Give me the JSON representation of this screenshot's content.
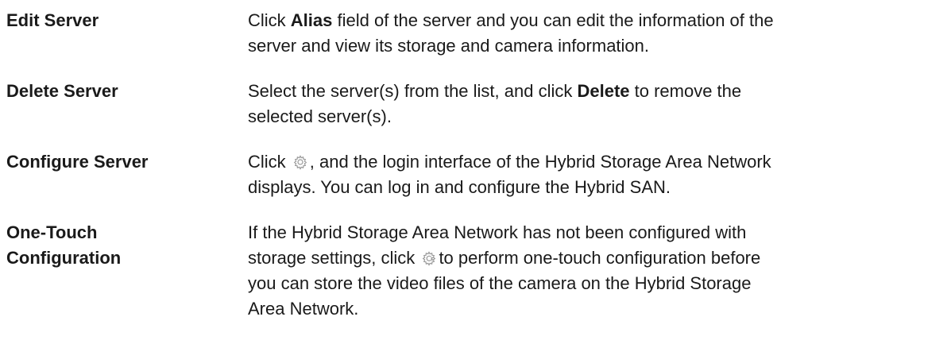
{
  "rows": [
    {
      "term": "Edit Server",
      "lines": [
        {
          "pre": "Click ",
          "bold": "Alias",
          "post": " field of the server and you can edit the information of the"
        },
        {
          "text": "server and view its storage and camera information."
        }
      ]
    },
    {
      "term": "Delete Server",
      "lines": [
        {
          "pre": "Select the server(s) from the list, and click ",
          "bold": "Delete",
          "post": " to remove the"
        },
        {
          "text": "selected server(s)."
        }
      ]
    },
    {
      "term": "Configure Server",
      "lines": [
        {
          "pre": "Click",
          "post": ", and the login interface of the Hybrid Storage Area Network"
        },
        {
          "text": "displays. You can log in and configure the Hybrid SAN."
        }
      ]
    },
    {
      "term_lines": [
        "One-Touch",
        "Configuration"
      ],
      "lines": [
        {
          "text": "If the Hybrid Storage Area Network has not been configured with"
        },
        {
          "pre": "storage settings, click",
          "post": "to perform one-touch configuration before"
        },
        {
          "text": "you can store the video files of the camera on the Hybrid Storage"
        },
        {
          "text": "Area Network."
        }
      ]
    }
  ],
  "icons": {
    "configure": "gear-icon",
    "one_touch": "one-touch-config-icon"
  }
}
